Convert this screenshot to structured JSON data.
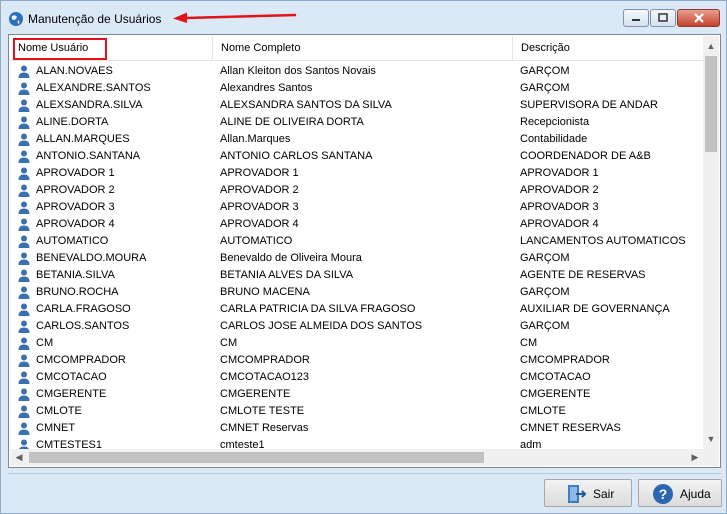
{
  "window": {
    "title": "Manutenção de Usuários",
    "icon": "app-globe-icon"
  },
  "columns": [
    "Nome Usuário",
    "Nome Completo",
    "Descrição"
  ],
  "rows": [
    [
      "ALAN.NOVAES",
      "Allan Kleiton dos Santos Novais",
      "GARÇOM"
    ],
    [
      "ALEXANDRE.SANTOS",
      "Alexandres Santos",
      "GARÇOM"
    ],
    [
      "ALEXSANDRA.SILVA",
      "ALEXSANDRA SANTOS DA SILVA",
      "SUPERVISORA DE ANDAR"
    ],
    [
      "ALINE.DORTA",
      "ALINE DE OLIVEIRA DORTA",
      "Recepcionista"
    ],
    [
      "ALLAN.MARQUES",
      "Allan.Marques",
      "Contabilidade"
    ],
    [
      "ANTONIO.SANTANA",
      "ANTONIO CARLOS SANTANA",
      "COORDENADOR DE A&B"
    ],
    [
      "APROVADOR 1",
      "APROVADOR 1",
      "APROVADOR 1"
    ],
    [
      "APROVADOR 2",
      "APROVADOR 2",
      "APROVADOR 2"
    ],
    [
      "APROVADOR 3",
      "APROVADOR 3",
      "APROVADOR 3"
    ],
    [
      "APROVADOR 4",
      "APROVADOR 4",
      "APROVADOR 4"
    ],
    [
      "AUTOMATICO",
      "AUTOMATICO",
      "LANCAMENTOS AUTOMATICOS"
    ],
    [
      "BENEVALDO.MOURA",
      "Benevaldo de Oliveira Moura",
      "GARÇOM"
    ],
    [
      "BETANIA.SILVA",
      "BETANIA ALVES DA SILVA",
      "AGENTE DE RESERVAS"
    ],
    [
      "BRUNO.ROCHA",
      "BRUNO MACENA",
      "GARÇOM"
    ],
    [
      "CARLA.FRAGOSO",
      "CARLA PATRICIA DA SILVA FRAGOSO",
      "AUXILIAR DE GOVERNANÇA"
    ],
    [
      "CARLOS.SANTOS",
      "CARLOS JOSE ALMEIDA DOS SANTOS",
      "GARÇOM"
    ],
    [
      "CM",
      "CM",
      "CM"
    ],
    [
      "CMCOMPRADOR",
      "CMCOMPRADOR",
      "CMCOMPRADOR"
    ],
    [
      "CMCOTACAO",
      "CMCOTACAO123",
      "CMCOTACAO"
    ],
    [
      "CMGERENTE",
      "CMGERENTE",
      "CMGERENTE"
    ],
    [
      "CMLOTE",
      "CMLOTE TESTE",
      "CMLOTE"
    ],
    [
      "CMNET",
      "CMNET Reservas",
      "CMNET RESERVAS"
    ],
    [
      "CMTESTES1",
      "cmteste1",
      "adm"
    ]
  ],
  "buttons": {
    "sair": "Sair",
    "ajuda": "Ajuda"
  },
  "colors": {
    "highlight": "#e0121a",
    "titlebar": "#dbe8f6",
    "user_icon": "#3a6fb0"
  }
}
